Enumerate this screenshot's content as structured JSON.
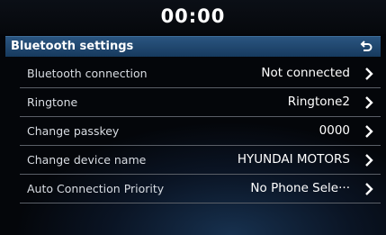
{
  "status": {
    "clock": "00:00"
  },
  "header": {
    "title": "Bluetooth settings",
    "back_icon": "back-return-icon"
  },
  "rows": [
    {
      "label": "Bluetooth connection",
      "value": "Not connected"
    },
    {
      "label": "Ringtone",
      "value": "Ringtone2"
    },
    {
      "label": "Change passkey",
      "value": "0000"
    },
    {
      "label": "Change device name",
      "value": "HYUNDAI MOTORS"
    },
    {
      "label": "Auto Connection Priority",
      "value": "No Phone Sele···"
    }
  ],
  "colors": {
    "header": "#1f4a72",
    "background": "#05070b",
    "divider": "#5a5f67"
  }
}
